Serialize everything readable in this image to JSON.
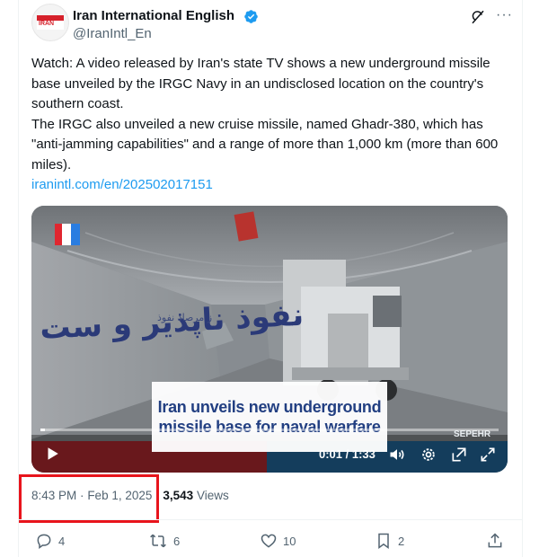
{
  "author": {
    "name": "Iran International English",
    "handle": "@IranIntl_En",
    "avatar_text": "IRAN"
  },
  "post": {
    "paragraph1": "Watch: A video released by Iran's state TV shows a new underground missile base unveiled by the IRGC Navy in an undisclosed location on the country's southern coast.",
    "paragraph2": "The IRGC also unveiled a new cruise missile, named Ghadr-380, which has \"anti-jamming capabilities\" and a range of more than 1,000 km (more than 600 miles).",
    "link": "iranintl.com/en/202502017151"
  },
  "video": {
    "caption_line1": "Iran unveils new underground",
    "caption_line2": "missile base for naval warfare",
    "watermark": "SEPEHR",
    "time": "0:01 / 1:33",
    "progress": 0.01
  },
  "meta": {
    "time": "8:43 PM",
    "separator": "·",
    "date": "Feb 1, 2025",
    "views_count": "3,543",
    "views_label": "Views"
  },
  "actions": {
    "replies": "4",
    "reposts": "6",
    "likes": "10",
    "bookmarks": "2"
  },
  "colors": {
    "accent": "#1d9bf0",
    "highlight_box": "#e8141c",
    "caption_text": "#1f3d82"
  }
}
